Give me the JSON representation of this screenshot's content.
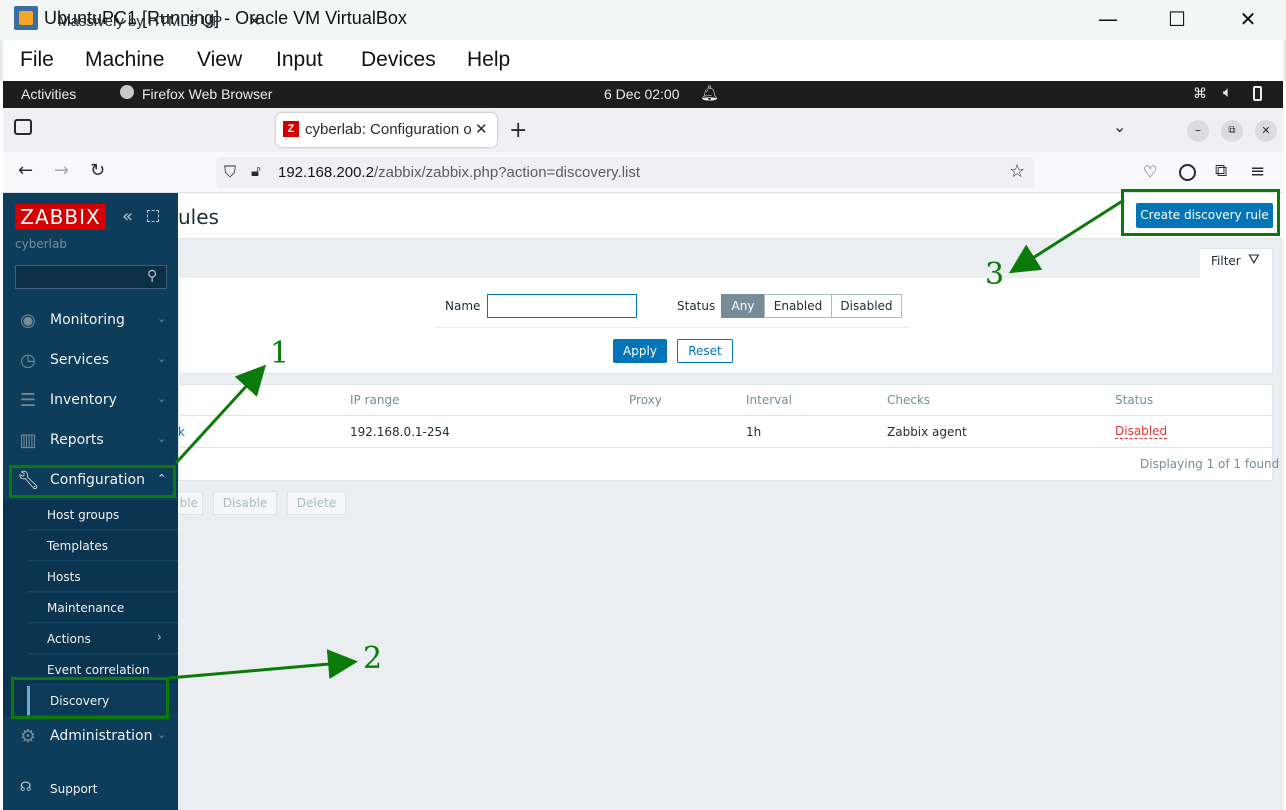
{
  "vbox": {
    "title": "UbuntuPC1 [Running] - Oracle VM VirtualBox",
    "controls": {
      "minimize": "—",
      "maximize": "☐",
      "close": "✕"
    },
    "menu": [
      "File",
      "Machine",
      "View",
      "Input",
      "Devices",
      "Help"
    ]
  },
  "gnome": {
    "activities": "Activities",
    "app": "Firefox Web Browser",
    "clock": "6 Dec  02:00"
  },
  "firefox": {
    "tabs": [
      {
        "label": "Massively by HTML5 UP",
        "active": false
      },
      {
        "label": "cyberlab: Configuration o",
        "active": true
      }
    ],
    "url_host": "192.168.200.2",
    "url_path": "/zabbix/zabbix.php?action=discovery.list"
  },
  "sidebar": {
    "logo": "ZABBIX",
    "server": "cyberlab",
    "menu": [
      {
        "label": "Monitoring",
        "icon": "eye-icon"
      },
      {
        "label": "Services",
        "icon": "stopwatch-icon"
      },
      {
        "label": "Inventory",
        "icon": "list-icon"
      },
      {
        "label": "Reports",
        "icon": "bar-chart-icon"
      },
      {
        "label": "Configuration",
        "icon": "wrench-icon"
      }
    ],
    "submenu": [
      "Host groups",
      "Templates",
      "Hosts",
      "Maintenance",
      "Actions",
      "Event correlation",
      "Discovery"
    ],
    "administration": "Administration",
    "support": "Support"
  },
  "page": {
    "title_fragment": "ules",
    "create_button": "Create discovery rule",
    "filter_tab": "Filter",
    "filter": {
      "name_label": "Name",
      "name_value": "",
      "status_label": "Status",
      "status_options": [
        "Any",
        "Enabled",
        "Disabled"
      ],
      "status_selected": "Any",
      "apply": "Apply",
      "reset": "Reset"
    },
    "table": {
      "headers": [
        "IP range",
        "Proxy",
        "Interval",
        "Checks",
        "Status"
      ],
      "row": {
        "name_fragment": "k",
        "ip_range": "192.168.0.1-254",
        "proxy": "",
        "interval": "1h",
        "checks": "Zabbix agent",
        "status": "Disabled"
      },
      "footer": "Displaying 1 of 1 found"
    },
    "mass_buttons": {
      "enable_fragment": "ble",
      "disable": "Disable",
      "delete": "Delete"
    }
  },
  "annotations": [
    "1",
    "2",
    "3"
  ],
  "colors": {
    "sidebar": "#0e3d5c",
    "accent": "#0275b8",
    "logo_red": "#d40000",
    "status_disabled": "#e33734",
    "annotation_green": "#0b7a0b"
  }
}
